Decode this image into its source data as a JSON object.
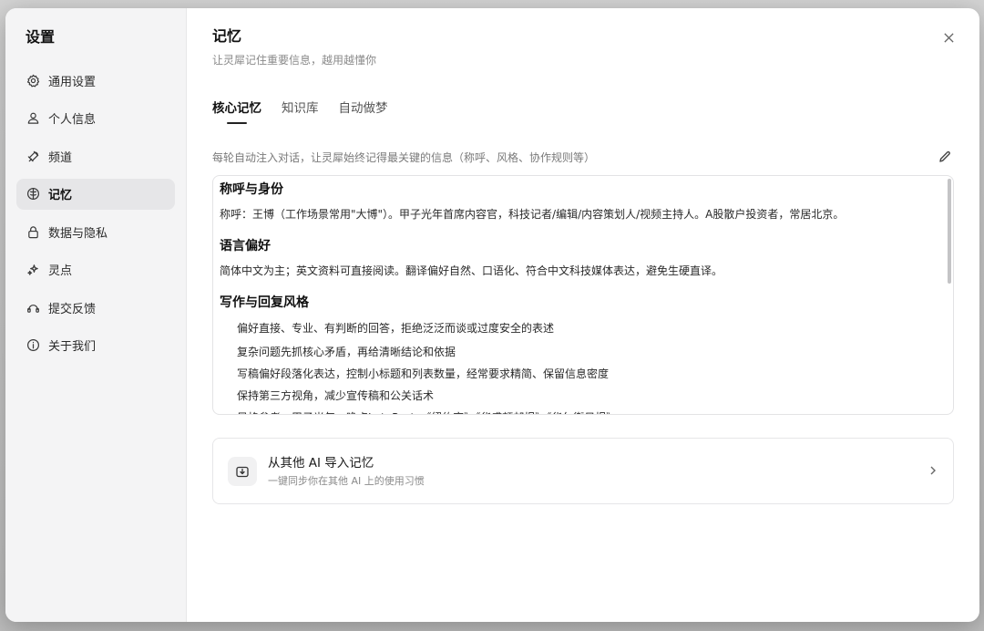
{
  "sidebar": {
    "title": "设置",
    "items": [
      {
        "label": "通用设置",
        "icon": "gear-icon"
      },
      {
        "label": "个人信息",
        "icon": "user-icon"
      },
      {
        "label": "频道",
        "icon": "channel-icon"
      },
      {
        "label": "记忆",
        "icon": "brain-icon",
        "active": true
      },
      {
        "label": "数据与隐私",
        "icon": "lock-icon"
      },
      {
        "label": "灵点",
        "icon": "sparkle-icon"
      },
      {
        "label": "提交反馈",
        "icon": "feedback-icon"
      },
      {
        "label": "关于我们",
        "icon": "info-icon"
      }
    ]
  },
  "main": {
    "title": "记忆",
    "subtitle": "让灵犀记住重要信息，越用越懂你",
    "close_icon": "close-icon",
    "tabs": [
      {
        "label": "核心记忆",
        "active": true
      },
      {
        "label": "知识库"
      },
      {
        "label": "自动做梦"
      }
    ],
    "memory_description": "每轮自动注入对话，让灵犀始终记得最关键的信息（称呼、风格、协作规则等）",
    "edit_icon": "pencil-icon",
    "memory_sections": [
      {
        "title": "称呼与身份",
        "text": "称呼：王博（工作场景常用\"大博\"）。甲子光年首席内容官，科技记者/编辑/内容策划人/视频主持人。A股散户投资者，常居北京。"
      },
      {
        "title": "语言偏好",
        "text": "简体中文为主；英文资料可直接阅读。翻译偏好自然、口语化、符合中文科技媒体表达，避免生硬直译。"
      },
      {
        "title": "写作与回复风格",
        "bullets": [
          "偏好直接、专业、有判断的回答，拒绝泛泛而谈或过度安全的表述",
          "复杂问题先抓核心矛盾，再给清晰结论和依据",
          "写稿偏好段落化表达，控制小标题和列表数量，经常要求精简、保留信息密度",
          "保持第三方视角，减少宣传稿和公关话术",
          "风格参考：甲子光年、晚点LatePost、《纽约客》《华盛顿邮报》《华尔街日报》"
        ]
      }
    ],
    "import_card": {
      "icon": "import-icon",
      "title": "从其他 AI 导入记忆",
      "subtitle": "一键同步你在其他 AI 上的使用习惯",
      "chevron": "chevron-right-icon"
    }
  },
  "colors": {
    "sidebar_bg": "#f4f4f5",
    "active_item_bg": "#e6e6e8",
    "text_primary": "#111111",
    "text_secondary": "#8a8a8a"
  }
}
